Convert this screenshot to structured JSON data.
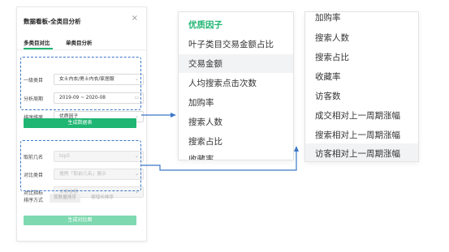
{
  "panel": {
    "title": "数据看板-全类目分析",
    "close_icon": "×",
    "tabs": [
      "多类目对比",
      "单类目分析"
    ],
    "fields": [
      {
        "label": "一级类目",
        "value": "女士内衣/男士内衣/家居服",
        "disabled": false,
        "icon": "chevron-down-icon"
      },
      {
        "label": "分析周期",
        "value": "2019-09 ~ 2020-08",
        "disabled": false,
        "icon": "calendar-icon"
      },
      {
        "label": "排序维度",
        "value": "优质因子",
        "disabled": false,
        "icon": "chevron-down-icon"
      }
    ],
    "generate_table_label": "生成数据表",
    "fields2": [
      {
        "label": "取前几名",
        "value": "top5",
        "disabled": true
      },
      {
        "label": "对比类目",
        "value": "搜熊「取前几名」展示",
        "disabled": true
      },
      {
        "label": "对比指标",
        "value": "交易金额",
        "disabled": true
      }
    ],
    "sort_label": "排序方式",
    "sort_options": [
      "按数量排序",
      "按增长排序"
    ],
    "generate_chart_label": "生成对比图"
  },
  "popup1": {
    "items": [
      "优质因子",
      "叶子类目交易金额占比",
      "交易金额",
      "人均搜索点击次数",
      "加购率",
      "搜索人数",
      "搜索占比",
      "收藏率"
    ],
    "highlighted_index": 2
  },
  "popup2": {
    "items": [
      "加购率",
      "搜索人数",
      "搜索占比",
      "收藏率",
      "访客数",
      "成交相对上一周期涨幅",
      "搜索相对上一周期涨幅",
      "访客相对上一周期涨幅"
    ],
    "highlighted_index": 7
  },
  "colors": {
    "accent": "#1fb572",
    "dashed_border": "#3b78c8",
    "arrow": "#3b78c8"
  }
}
